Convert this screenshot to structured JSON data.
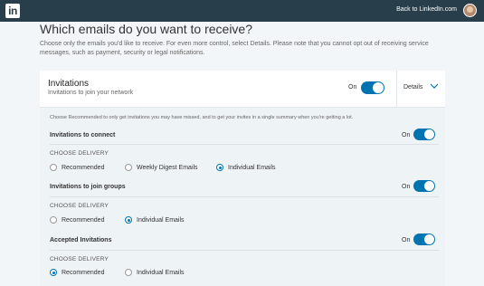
{
  "header": {
    "logo_text": "in",
    "back_link": "Back to LinkedIn.com"
  },
  "page": {
    "title": "Which emails do you want to receive?",
    "description": "Choose only the emails you'd like to receive. For even more control, select Details. Please note that you cannot opt out of receiving service messages, such as payment, security or legal notifications."
  },
  "card": {
    "name": "Invitations",
    "subtitle": "Invitations to join your network",
    "toggle_label": "On",
    "details_label": "Details",
    "help_text": "Choose Recommended to only get invitations you may have missed, and to get your invites in a single summary when you're getting a lot.",
    "delivery_heading": "CHOOSE DELIVERY",
    "rows": [
      {
        "label": "Invitations to connect",
        "toggle_label": "On",
        "options": [
          "Recommended",
          "Weekly Digest Emails",
          "Individual Emails"
        ],
        "selected": "Individual Emails"
      },
      {
        "label": "Invitations to join groups",
        "toggle_label": "On",
        "options": [
          "Recommended",
          "Individual Emails"
        ],
        "selected": "Individual Emails"
      },
      {
        "label": "Accepted Invitations",
        "toggle_label": "On",
        "options": [
          "Recommended",
          "Individual Emails"
        ],
        "selected": "Recommended"
      }
    ]
  },
  "colors": {
    "topbar": "#283e4a",
    "accent": "#0073b1",
    "page_bg": "#f3f6f8"
  }
}
